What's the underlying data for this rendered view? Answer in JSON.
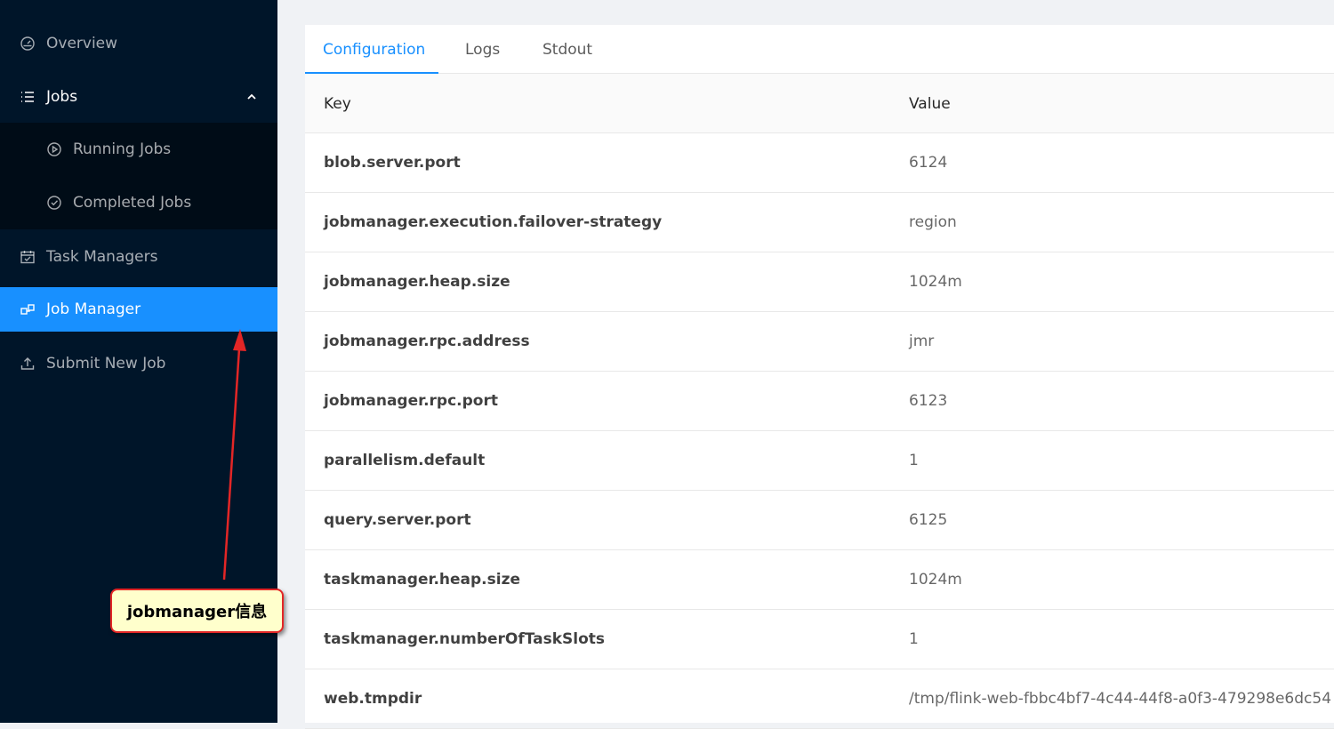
{
  "sidebar": {
    "items": [
      {
        "label": "Overview",
        "icon": "dashboard-icon"
      },
      {
        "label": "Jobs",
        "icon": "list-icon",
        "expanded": true
      },
      {
        "label": "Running Jobs",
        "icon": "play-circle-icon"
      },
      {
        "label": "Completed Jobs",
        "icon": "check-circle-icon"
      },
      {
        "label": "Task Managers",
        "icon": "calendar-icon"
      },
      {
        "label": "Job Manager",
        "icon": "cluster-icon",
        "active": true
      },
      {
        "label": "Submit New Job",
        "icon": "upload-icon"
      }
    ]
  },
  "tabs": [
    {
      "label": "Configuration",
      "active": true
    },
    {
      "label": "Logs"
    },
    {
      "label": "Stdout"
    }
  ],
  "table": {
    "headers": {
      "key": "Key",
      "value": "Value"
    },
    "rows": [
      {
        "key": "blob.server.port",
        "value": "6124"
      },
      {
        "key": "jobmanager.execution.failover-strategy",
        "value": "region"
      },
      {
        "key": "jobmanager.heap.size",
        "value": "1024m"
      },
      {
        "key": "jobmanager.rpc.address",
        "value": "jmr"
      },
      {
        "key": "jobmanager.rpc.port",
        "value": "6123"
      },
      {
        "key": "parallelism.default",
        "value": "1"
      },
      {
        "key": "query.server.port",
        "value": "6125"
      },
      {
        "key": "taskmanager.heap.size",
        "value": "1024m"
      },
      {
        "key": "taskmanager.numberOfTaskSlots",
        "value": "1"
      },
      {
        "key": "web.tmpdir",
        "value": "/tmp/flink-web-fbbc4bf7-4c44-44f8-a0f3-479298e6dc54"
      }
    ]
  },
  "annotation": {
    "text": "jobmanager信息"
  },
  "colors": {
    "sidebar_bg": "#001529",
    "accent": "#1890ff",
    "annotation_border": "#e32626",
    "annotation_bg": "#ffffcc"
  }
}
